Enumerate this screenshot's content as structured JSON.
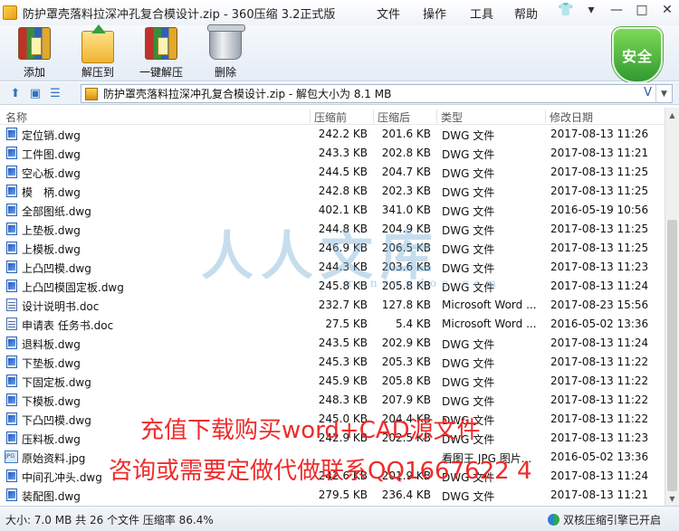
{
  "window": {
    "title": "防护罩壳落料拉深冲孔复合模设计.zip - 360压缩 3.2正式版",
    "menu": [
      "文件",
      "操作",
      "工具",
      "帮助"
    ]
  },
  "toolbar": {
    "buttons": [
      {
        "label": "添加",
        "icon": "add-books-icon"
      },
      {
        "label": "解压到",
        "icon": "extract-folder-icon"
      },
      {
        "label": "一键解压",
        "icon": "one-click-extract-icon"
      },
      {
        "label": "删除",
        "icon": "trash-can-icon"
      }
    ],
    "security_badge": "安全",
    "colors": {
      "accent": "#2f9a2f",
      "link_blue": "#2f73c7"
    }
  },
  "address": {
    "text": "防护罩壳落料拉深冲孔复合模设计.zip - 解包大小为 8.1 MB",
    "chevron": "V"
  },
  "columns": {
    "name": "名称",
    "compressed": "压缩前",
    "compressed_after": "压缩后",
    "type": "类型",
    "modified": "修改日期"
  },
  "files": [
    {
      "name": "定位销.dwg",
      "before": "242.2 KB",
      "after": "201.6 KB",
      "type": "DWG 文件",
      "date": "2017-08-13 11:26",
      "kind": "dwg"
    },
    {
      "name": "工件图.dwg",
      "before": "243.3 KB",
      "after": "202.8 KB",
      "type": "DWG 文件",
      "date": "2017-08-13 11:21",
      "kind": "dwg"
    },
    {
      "name": "空心板.dwg",
      "before": "244.5 KB",
      "after": "204.7 KB",
      "type": "DWG 文件",
      "date": "2017-08-13 11:25",
      "kind": "dwg"
    },
    {
      "name": "模　柄.dwg",
      "before": "242.8 KB",
      "after": "202.3 KB",
      "type": "DWG 文件",
      "date": "2017-08-13 11:25",
      "kind": "dwg"
    },
    {
      "name": "全部图纸.dwg",
      "before": "402.1 KB",
      "after": "341.0 KB",
      "type": "DWG 文件",
      "date": "2016-05-19 10:56",
      "kind": "dwg"
    },
    {
      "name": "上垫板.dwg",
      "before": "244.8 KB",
      "after": "204.9 KB",
      "type": "DWG 文件",
      "date": "2017-08-13 11:25",
      "kind": "dwg"
    },
    {
      "name": "上模板.dwg",
      "before": "246.9 KB",
      "after": "206.5 KB",
      "type": "DWG 文件",
      "date": "2017-08-13 11:25",
      "kind": "dwg"
    },
    {
      "name": "上凸凹模.dwg",
      "before": "244.3 KB",
      "after": "203.6 KB",
      "type": "DWG 文件",
      "date": "2017-08-13 11:23",
      "kind": "dwg"
    },
    {
      "name": "上凸凹模固定板.dwg",
      "before": "245.8 KB",
      "after": "205.8 KB",
      "type": "DWG 文件",
      "date": "2017-08-13 11:24",
      "kind": "dwg"
    },
    {
      "name": "设计说明书.doc",
      "before": "232.7 KB",
      "after": "127.8 KB",
      "type": "Microsoft Word ...",
      "date": "2017-08-23 15:56",
      "kind": "doc"
    },
    {
      "name": "申请表 任务书.doc",
      "before": "27.5 KB",
      "after": "5.4 KB",
      "type": "Microsoft Word ...",
      "date": "2016-05-02 13:36",
      "kind": "doc"
    },
    {
      "name": "退料板.dwg",
      "before": "243.5 KB",
      "after": "202.9 KB",
      "type": "DWG 文件",
      "date": "2017-08-13 11:24",
      "kind": "dwg"
    },
    {
      "name": "下垫板.dwg",
      "before": "245.3 KB",
      "after": "205.3 KB",
      "type": "DWG 文件",
      "date": "2017-08-13 11:22",
      "kind": "dwg"
    },
    {
      "name": "下固定板.dwg",
      "before": "245.9 KB",
      "after": "205.8 KB",
      "type": "DWG 文件",
      "date": "2017-08-13 11:22",
      "kind": "dwg"
    },
    {
      "name": "下模板.dwg",
      "before": "248.3 KB",
      "after": "207.9 KB",
      "type": "DWG 文件",
      "date": "2017-08-13 11:22",
      "kind": "dwg"
    },
    {
      "name": "下凸凹模.dwg",
      "before": "245.0 KB",
      "after": "204.4 KB",
      "type": "DWG 文件",
      "date": "2017-08-13 11:22",
      "kind": "dwg"
    },
    {
      "name": "压料板.dwg",
      "before": "242.9 KB",
      "after": "202.5 KB",
      "type": "DWG 文件",
      "date": "2017-08-13 11:23",
      "kind": "dwg"
    },
    {
      "name": "原始资料.jpg",
      "before": "",
      "after": "",
      "type": "看图王 JPG 图片...",
      "date": "2016-05-02 13:36",
      "kind": "jpg"
    },
    {
      "name": "中间孔冲头.dwg",
      "before": "242.6 KB",
      "after": "201.9 KB",
      "type": "DWG 文件",
      "date": "2017-08-13 11:24",
      "kind": "dwg"
    },
    {
      "name": "装配图.dwg",
      "before": "279.5 KB",
      "after": "236.4 KB",
      "type": "DWG 文件",
      "date": "2017-08-13 11:21",
      "kind": "dwg"
    }
  ],
  "status": {
    "summary": "大小: 7.0 MB 共 26 个文件 压缩率 86.4%",
    "engine": "双核压缩引擎已开启"
  },
  "watermark": {
    "logo": "人人文库",
    "url": "renrendoc.com",
    "promo_line1": "充值下载购买word+CAD源文件",
    "promo_line2": "咨询或需要定做代做联系QQ1667622 4"
  }
}
